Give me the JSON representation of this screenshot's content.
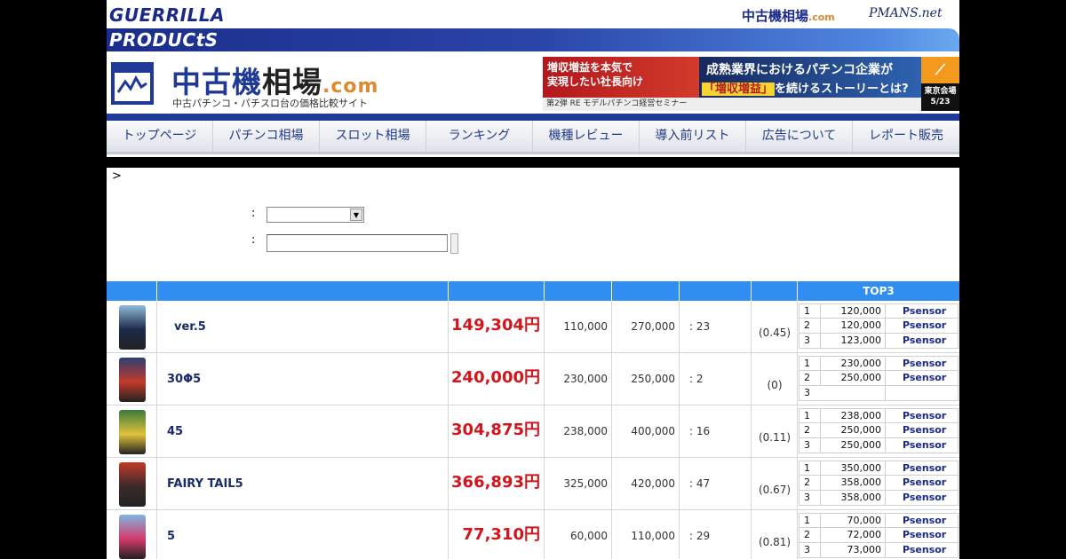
{
  "header": {
    "brand_line1": "GUERRILLA",
    "brand_line2": "PRODUCtS",
    "top_link_site": "中古機相場",
    "top_link_site_suffix": ".com",
    "top_link_pmans": "PMANS.net",
    "site_title_main": "中古機",
    "site_title_aux": "相場",
    "site_title_domain": ".com",
    "site_subtitle": "中古パチンコ・パチスロ台の価格比較サイト"
  },
  "banner": {
    "left_text": "増収増益を本気で\n実現したい社長向け",
    "bottom_text": "第2弾 RE モデルパチンコ経営セミナー",
    "mid_line1": "成熟業界におけるパチンコ企業が",
    "mid_highlight": "「増収増益」",
    "mid_line2_rest": "を続けるストーリーとは?",
    "right_line1": "東京会場",
    "right_line2": "5/23"
  },
  "nav": {
    "items": [
      "トップページ",
      "パチンコ相場",
      "スロット相場",
      "ランキング",
      "機種レビュー",
      "導入前リスト",
      "広告について",
      "レポート販売"
    ]
  },
  "breadcrumb": ">",
  "form": {
    "colon": ":"
  },
  "table": {
    "header_top3": "TOP3",
    "currency": "円",
    "rows": [
      {
        "name": "ver.5",
        "avg_price": "149,304",
        "min_price": "110,000",
        "max_price": "270,000",
        "count": ": 23",
        "ratio": "(0.45)",
        "top3": [
          {
            "rank": "1",
            "price": "120,000",
            "shop": "Psensor"
          },
          {
            "rank": "2",
            "price": "120,000",
            "shop": "Psensor"
          },
          {
            "rank": "3",
            "price": "123,000",
            "shop": "Psensor"
          }
        ]
      },
      {
        "name": "30Φ5",
        "avg_price": "240,000",
        "min_price": "230,000",
        "max_price": "250,000",
        "count": ": 2",
        "ratio": "(0)",
        "top3": [
          {
            "rank": "1",
            "price": "230,000",
            "shop": "Psensor"
          },
          {
            "rank": "2",
            "price": "250,000",
            "shop": "Psensor"
          },
          {
            "rank": "3",
            "price": "",
            "shop": ""
          }
        ]
      },
      {
        "name": "45",
        "avg_price": "304,875",
        "min_price": "238,000",
        "max_price": "400,000",
        "count": ": 16",
        "ratio": "(0.11)",
        "top3": [
          {
            "rank": "1",
            "price": "238,000",
            "shop": "Psensor"
          },
          {
            "rank": "2",
            "price": "250,000",
            "shop": "Psensor"
          },
          {
            "rank": "3",
            "price": "250,000",
            "shop": "Psensor"
          }
        ]
      },
      {
        "name": "FAIRY TAIL5",
        "avg_price": "366,893",
        "min_price": "325,000",
        "max_price": "420,000",
        "count": ": 47",
        "ratio": "(0.67)",
        "top3": [
          {
            "rank": "1",
            "price": "350,000",
            "shop": "Psensor"
          },
          {
            "rank": "2",
            "price": "358,000",
            "shop": "Psensor"
          },
          {
            "rank": "3",
            "price": "358,000",
            "shop": "Psensor"
          }
        ]
      },
      {
        "name": "5",
        "avg_price": "77,310",
        "min_price": "60,000",
        "max_price": "110,000",
        "count": ": 29",
        "ratio": "(0.81)",
        "top3": [
          {
            "rank": "1",
            "price": "70,000",
            "shop": "Psensor"
          },
          {
            "rank": "2",
            "price": "72,000",
            "shop": "Psensor"
          },
          {
            "rank": "3",
            "price": "73,000",
            "shop": "Psensor"
          }
        ]
      }
    ]
  },
  "colors": {
    "brand_blue": "#1f3a96",
    "table_header": "#2f8ef0",
    "price_red": "#d4141c",
    "accent_orange": "#e0892c"
  }
}
